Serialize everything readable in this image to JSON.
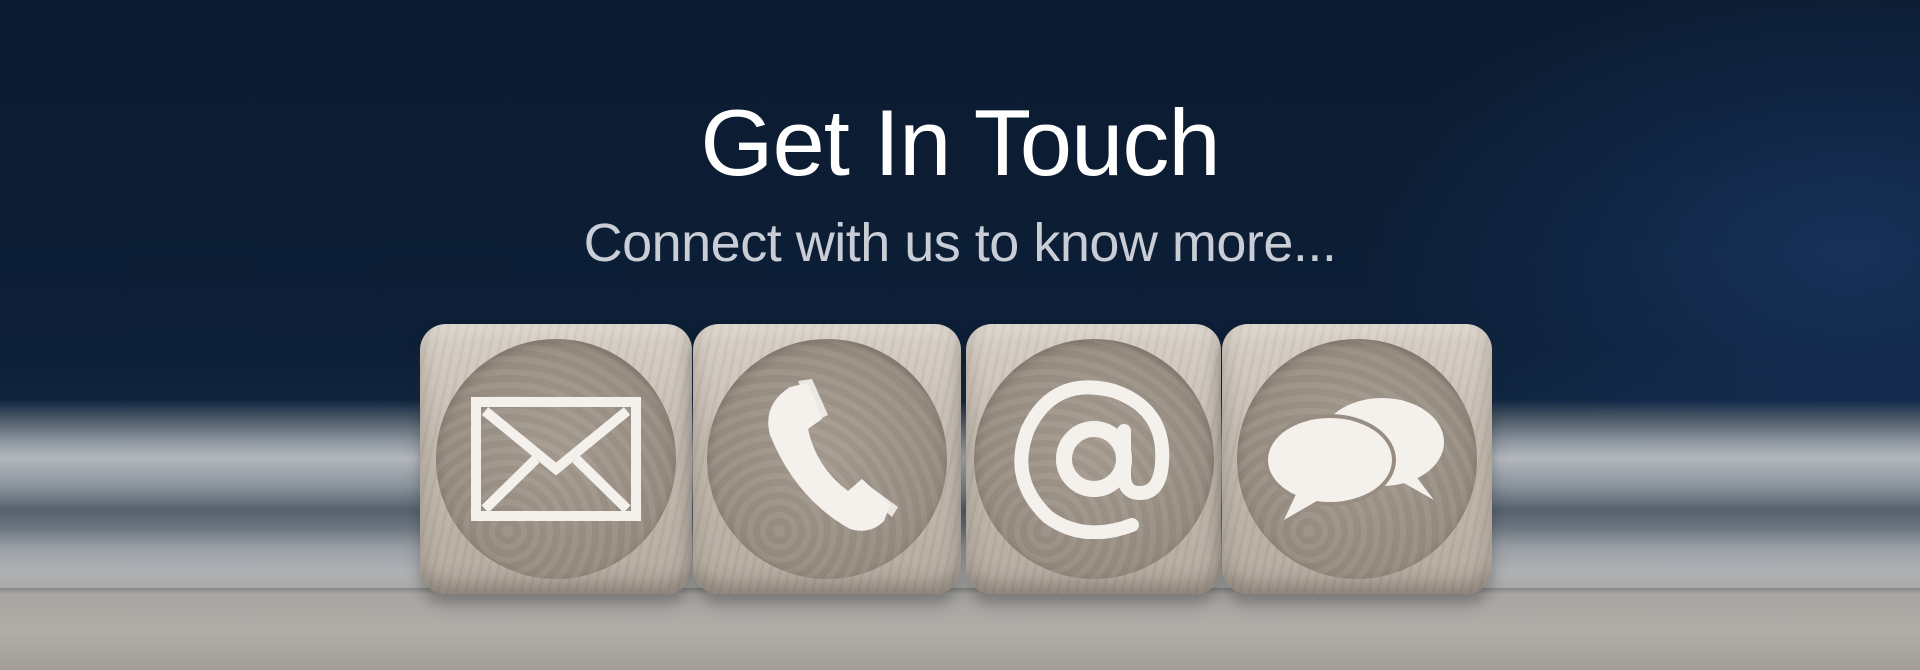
{
  "hero": {
    "title": "Get In Touch",
    "subtitle": "Connect with us to know more..."
  },
  "contact_blocks": [
    {
      "icon": "envelope-icon"
    },
    {
      "icon": "phone-icon"
    },
    {
      "icon": "at-sign-icon"
    },
    {
      "icon": "chat-bubbles-icon"
    }
  ],
  "colors": {
    "background_dark": "#0b1a2f",
    "title_text": "#ffffff",
    "subtitle_text": "#c9ced6",
    "wood": "#c4bbb0",
    "icon": "#f4f1ec"
  }
}
